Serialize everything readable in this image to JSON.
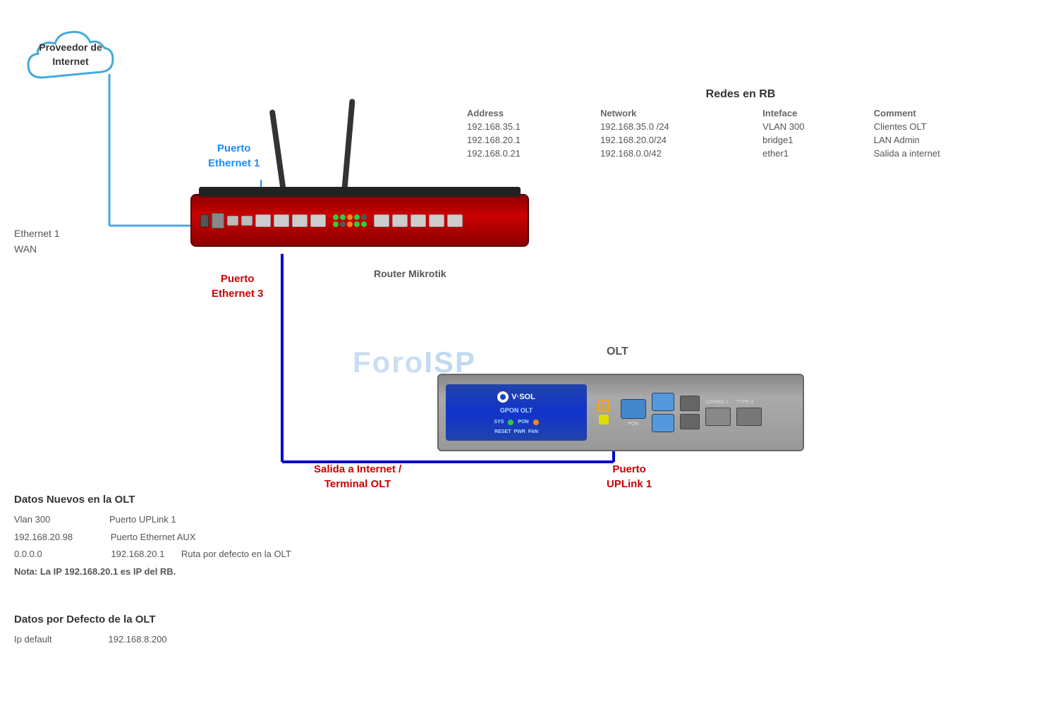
{
  "cloud": {
    "label_line1": "Proveedor de",
    "label_line2": "Internet"
  },
  "network_table": {
    "title": "Redes en RB",
    "headers": [
      "Address",
      "Network",
      "Inteface",
      "Comment"
    ],
    "rows": [
      [
        "192.168.35.1",
        "192.168.35.0 /24",
        "VLAN 300",
        "Clientes OLT"
      ],
      [
        "192.168.20.1",
        "192.168.20.0/24",
        "bridge1",
        "LAN Admin"
      ],
      [
        "192.168.0.21",
        "192.168.0.0/42",
        "ether1",
        "Salida a internet"
      ]
    ]
  },
  "labels": {
    "ethernet1_wan": "Ethernet 1\nWAN",
    "puerto_eth1": "Puerto\nEthernet 1",
    "puerto_eth3": "Puerto\nEthernet 3",
    "router_label": "Router Mikrotik",
    "olt_label": "OLT",
    "puerto_uplink": "Puerto\nUPLink 1",
    "salida_internet": "Salida a Internet /\nTerminal OLT"
  },
  "watermark": {
    "text_foro": "Foro",
    "text_isp": "ISP"
  },
  "datos_nuevos": {
    "title": "Datos Nuevos en  la OLT",
    "rows": [
      {
        "col1": "Vlan 300",
        "col2": "Puerto UPLink 1",
        "col3": ""
      },
      {
        "col1": "192.168.20.98",
        "col2": "Puerto Ethernet AUX",
        "col3": ""
      },
      {
        "col1": "0.0.0.0",
        "col2": "192.168.20.1",
        "col3": "Ruta  por defecto en la OLT"
      },
      {
        "col1": "Nota: La IP 192.168.20.1 es IP del RB.",
        "col2": "",
        "col3": ""
      }
    ]
  },
  "datos_defecto": {
    "title": "Datos por Defecto de la OLT",
    "rows": [
      {
        "col1": "Ip default",
        "col2": "192.168.8.200"
      }
    ]
  },
  "olt_device": {
    "logo": "V·SOL",
    "model": "GPON OLT"
  }
}
